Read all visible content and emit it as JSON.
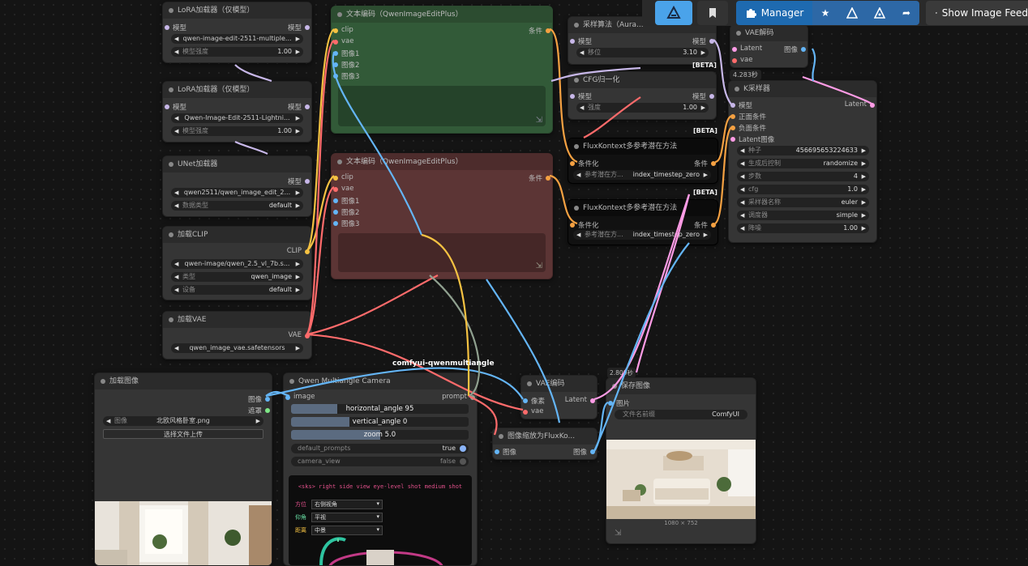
{
  "toolbar": {
    "manager_label": "Manager",
    "show_image_feed_label": "Show Image Feed",
    "icons": [
      "comfy-logo-icon",
      "bookmark-icon",
      "puzzle-icon",
      "star-icon",
      "triangle-tool-icon",
      "node-tool-icon",
      "share-icon",
      "image-feed-icon"
    ]
  },
  "graph_label": "comfyui-qwenmultiangle",
  "nodes": {
    "lora1": {
      "title": "LoRA加载器（仅模型）",
      "in": "模型",
      "out": "模型",
      "name": "qwen-image-edit-2511-multiple...",
      "strength_label": "模型强度",
      "strength": "1.00"
    },
    "lora2": {
      "title": "LoRA加载器（仅模型）",
      "in": "模型",
      "out": "模型",
      "name": "Qwen-Image-Edit-2511-Lightni...",
      "strength_label": "模型强度",
      "strength": "1.00"
    },
    "unet": {
      "title": "UNet加载器",
      "out": "模型",
      "name": "qwen2511/qwen_image_edit_2...",
      "dtype_label": "数据类型",
      "dtype": "default"
    },
    "clip": {
      "title": "加载CLIP",
      "out": "CLIP",
      "name": "qwen-image/qwen_2.5_vl_7b.s...",
      "type_label": "类型",
      "type": "qwen_image",
      "device_label": "设备",
      "device": "default"
    },
    "vae": {
      "title": "加载VAE",
      "out": "VAE",
      "name": "qwen_image_vae.safetensors"
    },
    "enc_pos": {
      "title": "文本编码（QwenImageEditPlus）",
      "inputs": [
        "clip",
        "vae",
        "图像1",
        "图像2",
        "图像3"
      ],
      "out": "条件"
    },
    "enc_neg": {
      "title": "文本编码（QwenImageEditPlus）",
      "inputs": [
        "clip",
        "vae",
        "图像1",
        "图像2",
        "图像3"
      ],
      "out": "条件"
    },
    "aura": {
      "title": "采样算法（Aura...",
      "in": "模型",
      "out": "模型",
      "shift_label": "移位",
      "shift": "3.10"
    },
    "cfg": {
      "title": "CFG归一化",
      "in": "模型",
      "out": "模型",
      "strength_label": "强度",
      "strength": "1.00"
    },
    "vaedecode_top": {
      "title": "VAE解码",
      "in1": "Latent",
      "in2": "vae",
      "out": "图像"
    },
    "time_label": "4.283秒",
    "ksampler": {
      "title": "K采样器",
      "inputs": [
        "模型",
        "正面条件",
        "负面条件",
        "Latent图像"
      ],
      "out": "Latent",
      "widgets": [
        {
          "label": "种子",
          "value": "456695653224633"
        },
        {
          "label": "生成后控制",
          "value": "randomize"
        },
        {
          "label": "步数",
          "value": "4"
        },
        {
          "label": "cfg",
          "value": "1.0"
        },
        {
          "label": "采样器名称",
          "value": "euler"
        },
        {
          "label": "调度器",
          "value": "simple"
        },
        {
          "label": "降噪",
          "value": "1.00"
        }
      ]
    },
    "flux1": {
      "title": "FluxKontext多参考潜在方法",
      "in": "条件化",
      "out": "条件",
      "method_label": "参考潜在方...",
      "method": "index_timestep_zero",
      "beta": "[BETA]"
    },
    "flux2": {
      "title": "FluxKontext多参考潜在方法",
      "in": "条件化",
      "out": "条件",
      "method_label": "参考潜在方...",
      "method": "index_timestep_zero",
      "beta": "[BETA]"
    },
    "beta_top": "[BETA]",
    "loadimg": {
      "title": "加载图像",
      "out1": "图像",
      "out2": "遮罩",
      "image_label": "图像",
      "image": "北欧风格卧室.png",
      "upload": "选择文件上传"
    },
    "qmc": {
      "title": "Qwen Multiangle Camera",
      "in": "image",
      "out": "prompt",
      "h_label": "horizontal_angle",
      "h_value": "95",
      "v_label": "vertical_angle",
      "v_value": "0",
      "z_label": "zoom",
      "z_value": "5.0",
      "dp_label": "default_prompts",
      "dp_value": "true",
      "cv_label": "camera_view",
      "cv_value": "false",
      "preview_text": "<sks> right side view eye-level shot medium shot",
      "selects": [
        {
          "label": "方位",
          "value": "右侧视角"
        },
        {
          "label": "仰角",
          "value": "平视"
        },
        {
          "label": "距离",
          "value": "中景"
        }
      ]
    },
    "vaedecode": {
      "title": "VAE编码",
      "in1": "像素",
      "in2": "vae",
      "out": "Latent"
    },
    "scale": {
      "title": "图像缩放为FluxKo...",
      "in": "图像",
      "out": "图像"
    },
    "save": {
      "title": "保存图像",
      "badge": "2.809秒",
      "in": "图片",
      "prefix_label": "文件名前缀",
      "prefix": "ComfyUI",
      "size": "1080 × 752"
    }
  }
}
